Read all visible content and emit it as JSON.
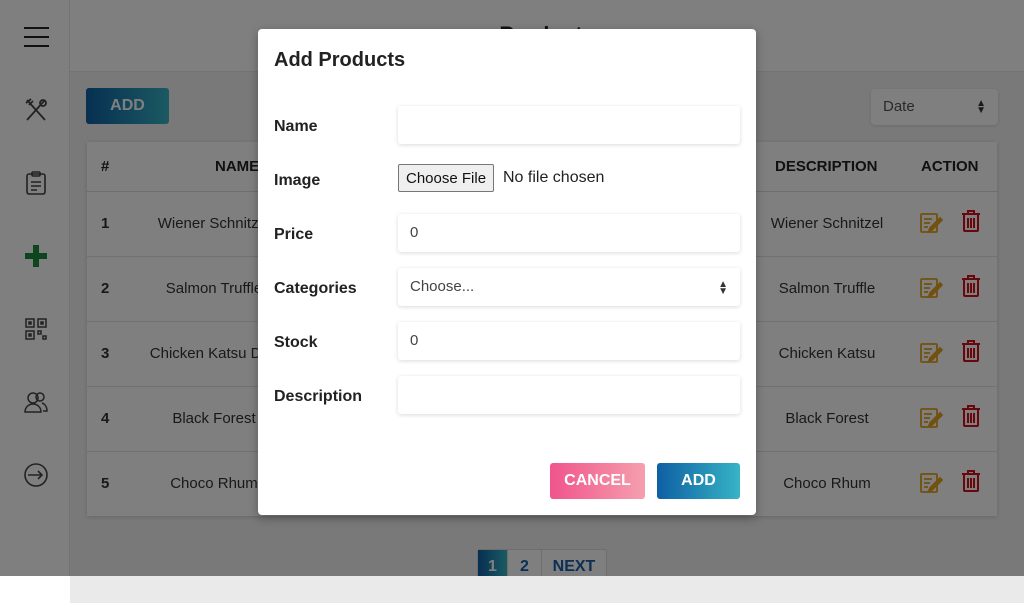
{
  "topbar": {
    "title": "Products"
  },
  "sidebar": {
    "items": [
      {
        "icon": "utensils-icon"
      },
      {
        "icon": "clipboard-icon"
      },
      {
        "icon": "plus-icon"
      },
      {
        "icon": "qrcode-icon"
      },
      {
        "icon": "users-icon"
      },
      {
        "icon": "logout-icon"
      }
    ]
  },
  "toolbar": {
    "add_label": "ADD",
    "sort_value": "Date"
  },
  "table": {
    "columns": [
      "#",
      "NAME",
      "DESCRIPTION",
      "ACTION"
    ],
    "rows": [
      {
        "num": "1",
        "name": "Wiener Schnitzel",
        "description": "Wiener Schnitzel"
      },
      {
        "num": "2",
        "name": "Salmon Truffle",
        "description": "Salmon Truffle"
      },
      {
        "num": "3",
        "name": "Chicken Katsu Don",
        "description": "Chicken Katsu"
      },
      {
        "num": "4",
        "name": "Black Forest",
        "description": "Black Forest"
      },
      {
        "num": "5",
        "name": "Choco Rhum",
        "description": "Choco Rhum"
      }
    ]
  },
  "pagination": {
    "pages": [
      "1",
      "2"
    ],
    "next_label": "NEXT",
    "active_page": "1"
  },
  "modal": {
    "title": "Add Products",
    "fields": {
      "name": {
        "label": "Name",
        "value": ""
      },
      "image": {
        "label": "Image",
        "button_label": "Choose File",
        "status": "No file chosen"
      },
      "price": {
        "label": "Price",
        "value": "0"
      },
      "categories": {
        "label": "Categories",
        "value": "Choose..."
      },
      "stock": {
        "label": "Stock",
        "value": "0"
      },
      "description": {
        "label": "Description",
        "value": ""
      }
    },
    "cancel_label": "CANCEL",
    "submit_label": "ADD"
  },
  "colors": {
    "brand_gradient_start": "#0e5fa3",
    "brand_gradient_end": "#37b4c6",
    "cancel_gradient_start": "#f0548b",
    "cancel_gradient_end": "#f59fae",
    "edit_icon": "#e3a31b",
    "delete_icon": "#d0101b",
    "add_icon": "#1e8a3c"
  }
}
